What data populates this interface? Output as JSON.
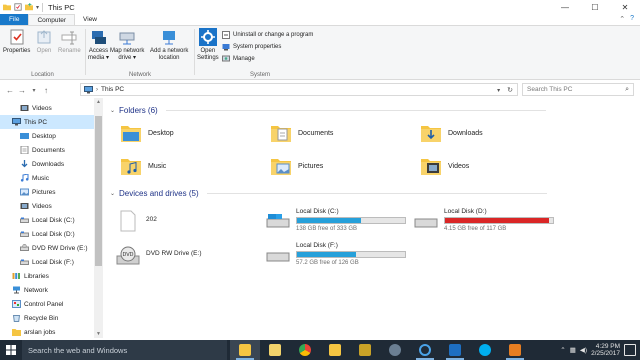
{
  "window": {
    "title": "This PC",
    "controls": {
      "minimize": "—",
      "maximize": "☐",
      "close": "✕"
    }
  },
  "ribbon": {
    "tabs": [
      "File",
      "Computer",
      "View"
    ],
    "location_group": {
      "label": "Location",
      "buttons": [
        "Properties",
        "Open",
        "Rename"
      ]
    },
    "network_group": {
      "label": "Network",
      "buttons": [
        {
          "line1": "Access",
          "line2": "media ▾"
        },
        {
          "line1": "Map network",
          "line2": "drive ▾"
        },
        {
          "line1": "Add a network",
          "line2": "location"
        }
      ]
    },
    "system_group": {
      "label": "System",
      "open_settings": {
        "line1": "Open",
        "line2": "Settings"
      },
      "items": [
        "Uninstall or change a program",
        "System properties",
        "Manage"
      ]
    }
  },
  "address": {
    "path": "This PC",
    "search_placeholder": "Search This PC"
  },
  "nav_pane": {
    "items": [
      {
        "label": "Videos",
        "icon": "videos-icon"
      },
      {
        "label": "This PC",
        "icon": "computer-icon",
        "selected": true
      },
      {
        "label": "Desktop",
        "icon": "desktop-folder-icon"
      },
      {
        "label": "Documents",
        "icon": "documents-folder-icon"
      },
      {
        "label": "Downloads",
        "icon": "downloads-folder-icon"
      },
      {
        "label": "Music",
        "icon": "music-folder-icon"
      },
      {
        "label": "Pictures",
        "icon": "pictures-folder-icon"
      },
      {
        "label": "Videos",
        "icon": "videos-icon"
      },
      {
        "label": "Local Disk (C:)",
        "icon": "drive-icon"
      },
      {
        "label": "Local Disk (D:)",
        "icon": "drive-icon"
      },
      {
        "label": "DVD RW Drive (E:)",
        "icon": "dvd-drive-icon"
      },
      {
        "label": "Local Disk (F:)",
        "icon": "drive-icon"
      },
      {
        "label": "Libraries",
        "icon": "libraries-icon"
      },
      {
        "label": "Network",
        "icon": "network-icon"
      },
      {
        "label": "Control Panel",
        "icon": "control-panel-icon"
      },
      {
        "label": "Recycle Bin",
        "icon": "recycle-bin-icon"
      },
      {
        "label": "arslan jobs",
        "icon": "folder-icon"
      }
    ]
  },
  "content": {
    "folders_header": "Folders (6)",
    "folders": [
      "Desktop",
      "Documents",
      "Downloads",
      "Music",
      "Pictures",
      "Videos"
    ],
    "devices_header": "Devices and drives (5)",
    "devices": [
      {
        "name": "202",
        "type": "blank"
      },
      {
        "name": "Local Disk (C:)",
        "free": "138 GB free of 333 GB",
        "used_fraction": 0.59,
        "color": "#26a0da"
      },
      {
        "name": "Local Disk (D:)",
        "free": "4.15 GB free of 117 GB",
        "used_fraction": 0.96,
        "color": "#da2626"
      },
      {
        "name": "DVD RW Drive (E:)",
        "type": "dvd"
      },
      {
        "name": "Local Disk (F:)",
        "free": "57.2 GB free of 126 GB",
        "used_fraction": 0.55,
        "color": "#26a0da"
      }
    ]
  },
  "taskbar": {
    "search_text": "Search the web and Windows",
    "time": "4:29 PM",
    "date": "2/25/2017"
  }
}
